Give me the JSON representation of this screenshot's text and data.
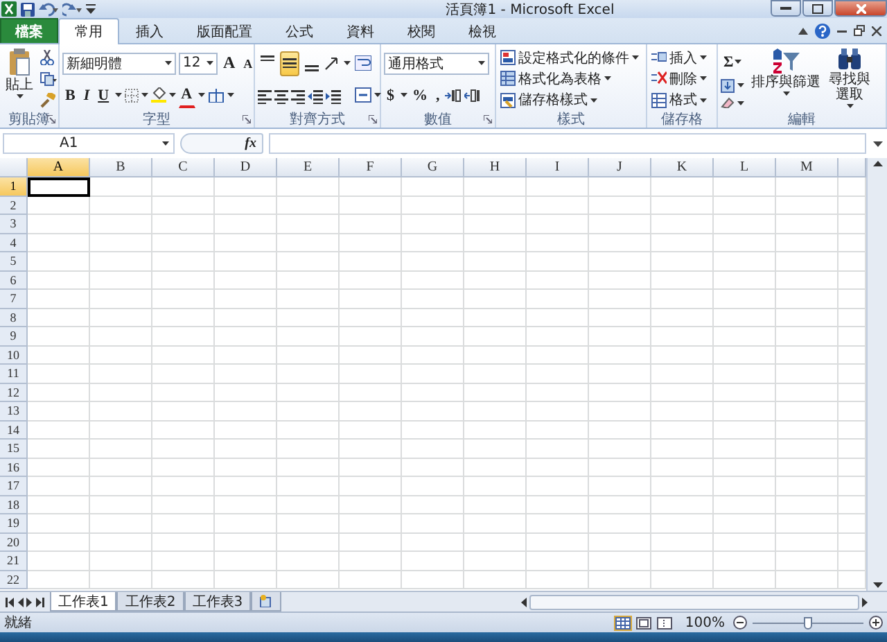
{
  "title_bar": {
    "title": "活頁簿1 - Microsoft Excel"
  },
  "ribbon_tabs": [
    {
      "label": "檔案",
      "kind": "file",
      "selected": false
    },
    {
      "label": "常用",
      "kind": "tab",
      "selected": true
    },
    {
      "label": "插入",
      "kind": "tab",
      "selected": false
    },
    {
      "label": "版面配置",
      "kind": "tab",
      "selected": false
    },
    {
      "label": "公式",
      "kind": "tab",
      "selected": false
    },
    {
      "label": "資料",
      "kind": "tab",
      "selected": false
    },
    {
      "label": "校閱",
      "kind": "tab",
      "selected": false
    },
    {
      "label": "檢視",
      "kind": "tab",
      "selected": false
    }
  ],
  "ribbon": {
    "clipboard": {
      "paste": "貼上",
      "label": "剪貼簿"
    },
    "font": {
      "name": "新細明體",
      "size": "12",
      "grow": "A",
      "shrink": "A",
      "bold": "B",
      "italic": "I",
      "underline": "U",
      "font_color_glyph": "A",
      "label": "字型"
    },
    "alignment": {
      "vertical": [
        {
          "selected": false
        },
        {
          "selected": true
        },
        {
          "selected": false
        }
      ],
      "label": "對齊方式"
    },
    "number": {
      "format": "通用格式",
      "currency": "$",
      "percent": "%",
      "comma": ",",
      "label": "數值"
    },
    "styles": {
      "items": [
        "設定格式化的條件",
        "格式化為表格",
        "儲存格樣式"
      ],
      "label": "樣式"
    },
    "cells": {
      "items": [
        "插入",
        "刪除",
        "格式"
      ],
      "label": "儲存格"
    },
    "editing": {
      "sum": "Σ",
      "sort": "排序與篩選",
      "find": "尋找與選取",
      "label": "編輯"
    }
  },
  "formula_bar": {
    "name_box": "A1",
    "function_button": "fx"
  },
  "sheet": {
    "columns": [
      {
        "label": "A",
        "selected": true
      },
      {
        "label": "B",
        "selected": false
      },
      {
        "label": "C",
        "selected": false
      },
      {
        "label": "D",
        "selected": false
      },
      {
        "label": "E",
        "selected": false
      },
      {
        "label": "F",
        "selected": false
      },
      {
        "label": "G",
        "selected": false
      },
      {
        "label": "H",
        "selected": false
      },
      {
        "label": "I",
        "selected": false
      },
      {
        "label": "J",
        "selected": false
      },
      {
        "label": "K",
        "selected": false
      },
      {
        "label": "L",
        "selected": false
      },
      {
        "label": "M",
        "selected": false
      }
    ],
    "rows": [
      {
        "label": "1",
        "selected": true
      },
      {
        "label": "2",
        "selected": false
      },
      {
        "label": "3",
        "selected": false
      },
      {
        "label": "4",
        "selected": false
      },
      {
        "label": "5",
        "selected": false
      },
      {
        "label": "6",
        "selected": false
      },
      {
        "label": "7",
        "selected": false
      },
      {
        "label": "8",
        "selected": false
      },
      {
        "label": "9",
        "selected": false
      },
      {
        "label": "10",
        "selected": false
      },
      {
        "label": "11",
        "selected": false
      },
      {
        "label": "12",
        "selected": false
      },
      {
        "label": "13",
        "selected": false
      },
      {
        "label": "14",
        "selected": false
      },
      {
        "label": "15",
        "selected": false
      },
      {
        "label": "16",
        "selected": false
      },
      {
        "label": "17",
        "selected": false
      },
      {
        "label": "18",
        "selected": false
      },
      {
        "label": "19",
        "selected": false
      },
      {
        "label": "20",
        "selected": false
      },
      {
        "label": "21",
        "selected": false
      },
      {
        "label": "22",
        "selected": false
      }
    ]
  },
  "sheet_tabs": [
    {
      "label": "工作表1",
      "selected": true
    },
    {
      "label": "工作表2",
      "selected": false
    },
    {
      "label": "工作表3",
      "selected": false
    }
  ],
  "status_bar": {
    "status": "就緒",
    "views": [
      {
        "selected": true
      },
      {
        "selected": false
      },
      {
        "selected": false
      }
    ],
    "zoom": "100%",
    "zoom_slider": {
      "level": 0.5
    }
  }
}
